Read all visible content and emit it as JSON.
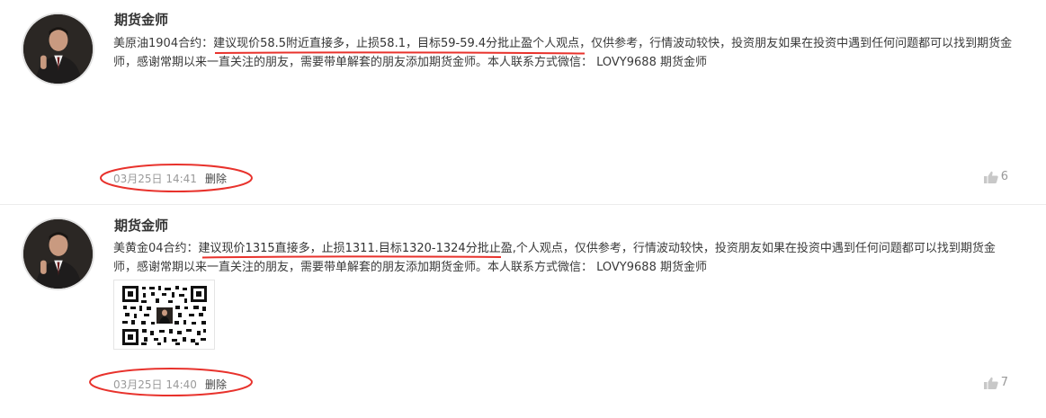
{
  "posts": [
    {
      "author": "期货金师",
      "content_prefix": "美原油1904合约：",
      "content_highlight": "建议现价58.5附近直接多，止损58.1，目标59-59.4分批止盈",
      "content_rest": "个人观点，仅供参考，行情波动较快，投资朋友如果在投资中遇到任何问题都可以找到期货金师，感谢常期以来一直关注的朋友，需要带单解套的朋友添加期货金师。本人联系方式微信： LOVY9688 期货金师",
      "time": "03月25日 14:41",
      "delete_label": "删除",
      "likes": "6",
      "avatar_icon": "user-avatar",
      "annotation_color": "#e8322c"
    },
    {
      "author": "期货金师",
      "content_prefix": "美黄金04合约：",
      "content_highlight": "建议现价1315直接多，止损1311.目标1320-1324分批止盈",
      "content_rest": ",个人观点，仅供参考，行情波动较快，投资朋友如果在投资中遇到任何问题都可以找到期货金师，感谢常期以来一直关注的朋友，需要带单解套的朋友添加期货金师。本人联系方式微信： LOVY9688 期货金师",
      "time": "03月25日 14:40",
      "delete_label": "删除",
      "likes": "7",
      "avatar_icon": "user-avatar",
      "attachment_icon": "qr-code-icon",
      "annotation_color": "#e8322c"
    }
  ]
}
